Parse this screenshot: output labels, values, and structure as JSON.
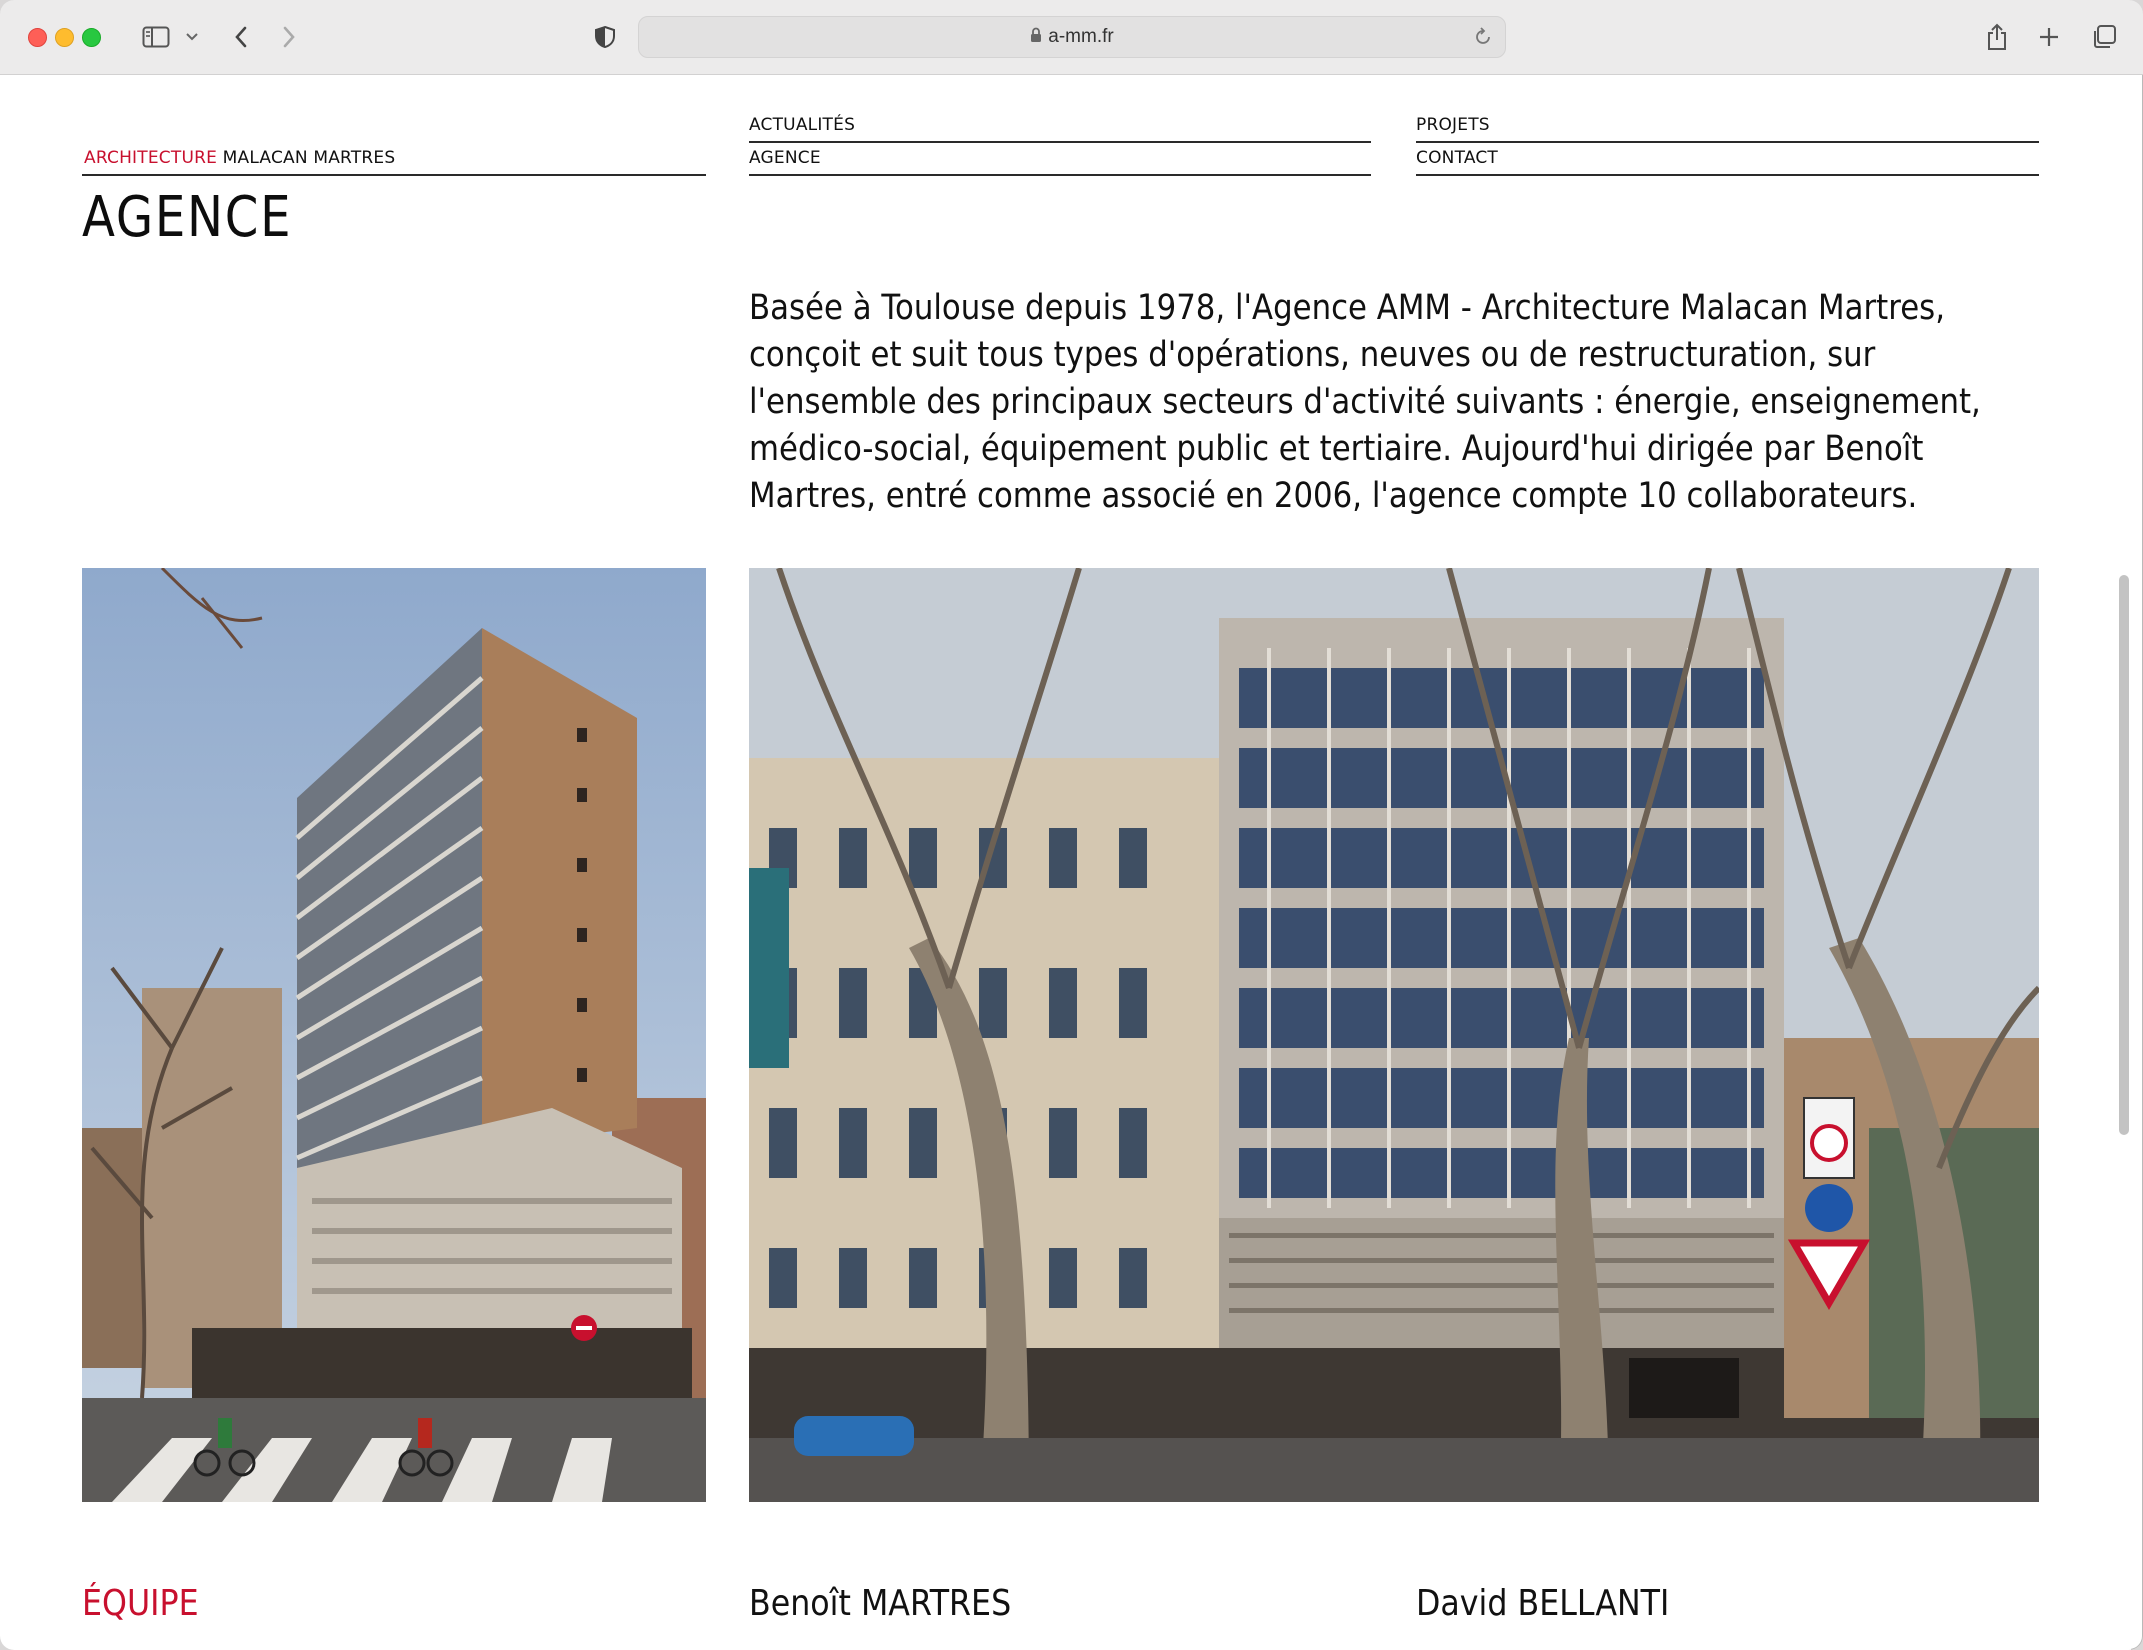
{
  "browser": {
    "url": "a-mm.fr"
  },
  "site": {
    "brand_first": "ARCHITECTURE",
    "brand_rest": "MALACAN MARTRES",
    "nav": {
      "actualites": "ACTUALITÉS",
      "agence": "AGENCE",
      "projets": "PROJETS",
      "contact": "CONTACT"
    },
    "accent_color": "#c8102e"
  },
  "main": {
    "title": "AGENCE",
    "intro": "Basée à Toulouse depuis 1978, l'Agence AMM - Architecture Malacan Martres, conçoit et suit tous types d'opérations, neuves ou de restructuration, sur l'ensemble des principaux secteurs d'activité suivants : énergie, enseignement, médico-social, équipement public et tertiaire. Aujourd'hui dirigée par Benoît Martres, entré comme associé en 2006, l'agence compte 10 collaborateurs.",
    "team_label": "ÉQUIPE",
    "team": [
      "Benoît MARTRES",
      "David BELLANTI"
    ]
  }
}
